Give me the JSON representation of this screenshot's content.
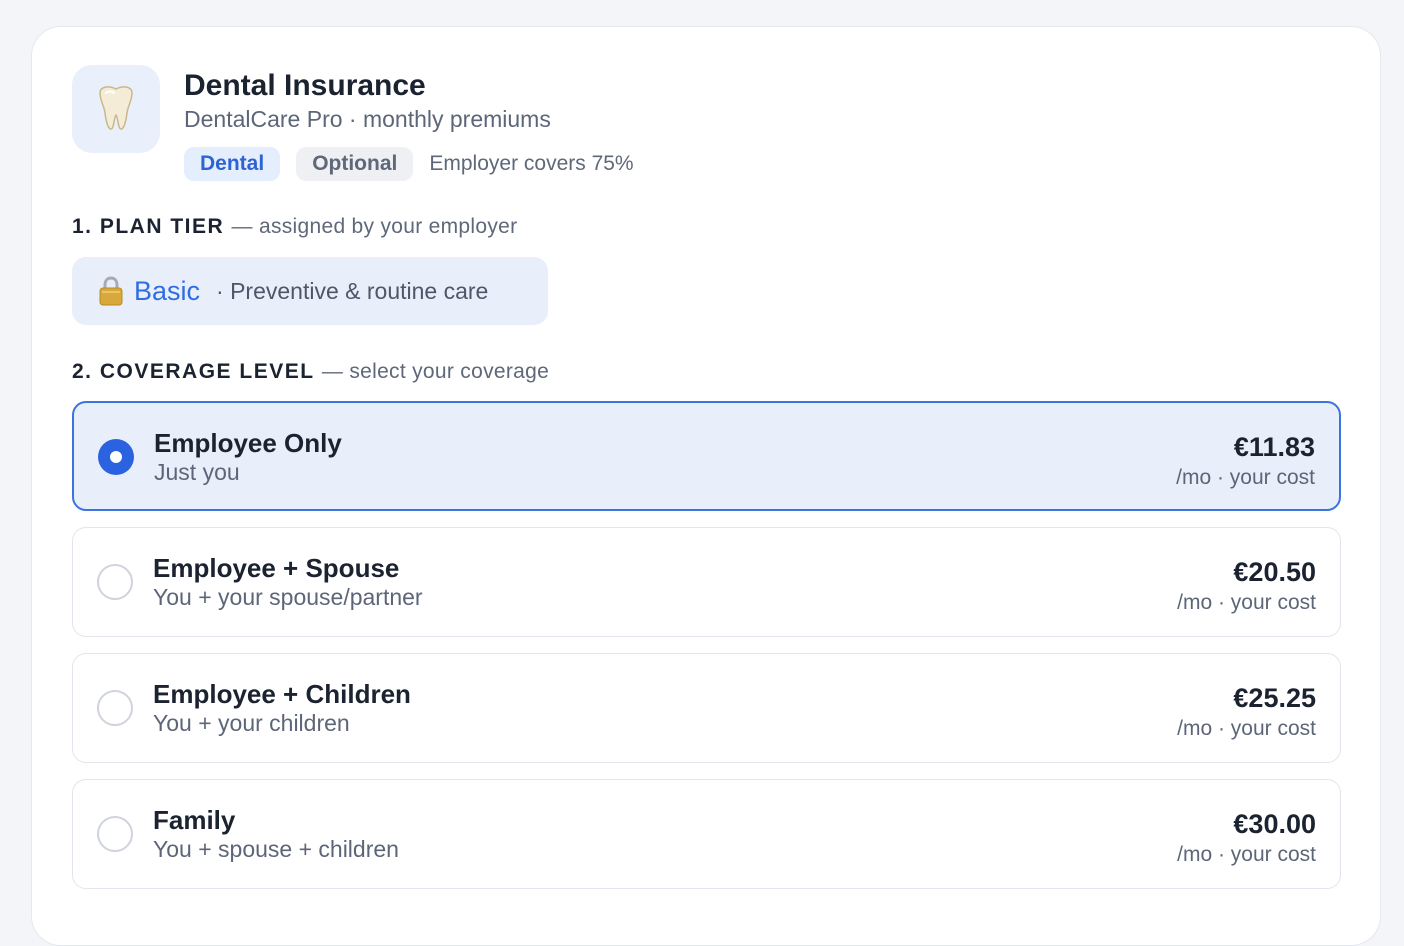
{
  "header": {
    "icon": "tooth-icon",
    "title": "Dental Insurance",
    "subtitle": "DentalCare Pro · monthly premiums",
    "badges": {
      "category": "Dental",
      "status": "Optional",
      "employer_note": "Employer covers 75%"
    }
  },
  "plan_tier": {
    "step": "1. PLAN TIER",
    "hint": "— assigned by your employer",
    "lock_icon": "lock-icon",
    "name": "Basic",
    "description": "· Preventive & routine care"
  },
  "coverage": {
    "step": "2. COVERAGE LEVEL",
    "hint": "— select your coverage",
    "selected_index": 0,
    "options": [
      {
        "name": "Employee Only",
        "description": "Just you",
        "price": "€11.83",
        "price_note": "/mo · your cost"
      },
      {
        "name": "Employee + Spouse",
        "description": "You + your spouse/partner",
        "price": "€20.50",
        "price_note": "/mo · your cost"
      },
      {
        "name": "Employee + Children",
        "description": "You + your children",
        "price": "€25.25",
        "price_note": "/mo · your cost"
      },
      {
        "name": "Family",
        "description": "You + spouse + children",
        "price": "€30.00",
        "price_note": "/mo · your cost"
      }
    ]
  },
  "colors": {
    "accent": "#2b62df",
    "selected_bg": "#e9eefb",
    "tier_text": "#2f6de0"
  }
}
